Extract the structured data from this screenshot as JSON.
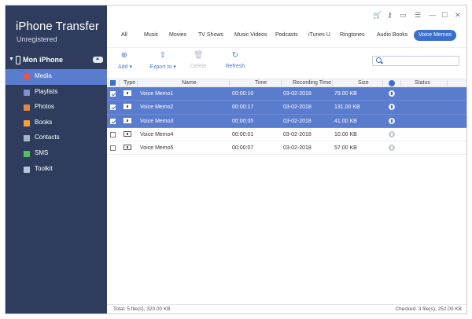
{
  "app": {
    "title": "iPhone Transfer",
    "subtitle": "Unregistered"
  },
  "device": {
    "name": "Mon iPhone"
  },
  "sidebar": {
    "items": [
      {
        "label": "Media",
        "icon": "music-icon",
        "color": "#e8534f",
        "active": true
      },
      {
        "label": "Playlists",
        "icon": "playlist-icon",
        "color": "#7e8fcc",
        "active": false
      },
      {
        "label": "Photos",
        "icon": "photos-icon",
        "color": "#e0884a",
        "active": false
      },
      {
        "label": "Books",
        "icon": "books-icon",
        "color": "#f0a23a",
        "active": false
      },
      {
        "label": "Contacts",
        "icon": "contacts-icon",
        "color": "#a9b4c6",
        "active": false
      },
      {
        "label": "SMS",
        "icon": "sms-icon",
        "color": "#4fc35c",
        "active": false
      },
      {
        "label": "Toolkit",
        "icon": "toolkit-icon",
        "color": "#b7c3d9",
        "active": false
      }
    ]
  },
  "titlebar": {
    "icons": [
      "cart-icon",
      "key-icon",
      "chat-icon",
      "menu-icon",
      "minimize-icon",
      "maximize-icon",
      "close-icon"
    ]
  },
  "tabs": [
    {
      "label": "All"
    },
    {
      "label": "Music"
    },
    {
      "label": "Movies"
    },
    {
      "label": "TV Shows"
    },
    {
      "label": "Music Videos"
    },
    {
      "label": "Podcasts"
    },
    {
      "label": "iTunes U"
    },
    {
      "label": "Ringtones"
    },
    {
      "label": "Audio Books"
    },
    {
      "label": "Voice Memos",
      "active": true
    }
  ],
  "toolbar": {
    "add_label": "Add",
    "export_label": "Export to",
    "delete_label": "Delete",
    "refresh_label": "Refresh"
  },
  "search": {
    "placeholder": "",
    "value": ""
  },
  "table": {
    "headers": {
      "type": "Type",
      "name": "Name",
      "time": "Time",
      "recording_time": "Recording Time",
      "size": "Size",
      "status": "Status"
    },
    "rows": [
      {
        "name": "Voice Memo1",
        "time": "00:00:10",
        "recording_time": "03-02-2018",
        "size": "79.00 KB",
        "selected": true
      },
      {
        "name": "Voice Memo2",
        "time": "00:00:17",
        "recording_time": "03-02-2018",
        "size": "131.00 KB",
        "selected": true
      },
      {
        "name": "Voice Memo3",
        "time": "00:00:05",
        "recording_time": "03-02-2018",
        "size": "41.00 KB",
        "selected": true
      },
      {
        "name": "Voice Memo4",
        "time": "00:00:01",
        "recording_time": "03-02-2018",
        "size": "10.00 KB",
        "selected": false
      },
      {
        "name": "Voice Memo5",
        "time": "00:00:07",
        "recording_time": "03-02-2018",
        "size": "57.00 KB",
        "selected": false
      }
    ]
  },
  "status": {
    "total": "Total: 5 file(s), 320.00 KB",
    "checked": "Checked: 3 file(s), 252.00 KB"
  }
}
